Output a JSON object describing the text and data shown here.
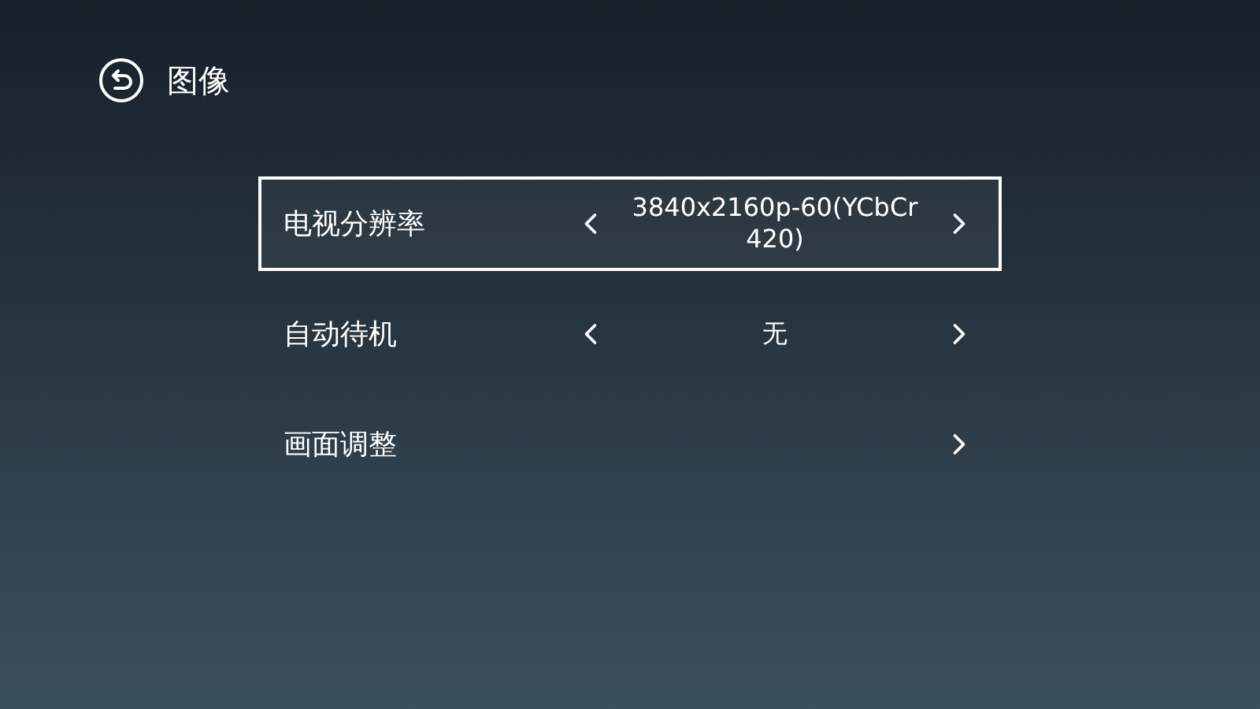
{
  "header": {
    "title": "图像"
  },
  "settings": [
    {
      "label": "电视分辨率",
      "value": "3840x2160p-60(YCbCr 420)",
      "kind": "choice",
      "selected": true
    },
    {
      "label": "自动待机",
      "value": "无",
      "kind": "choice",
      "selected": false
    },
    {
      "label": "画面调整",
      "kind": "link",
      "selected": false
    }
  ]
}
